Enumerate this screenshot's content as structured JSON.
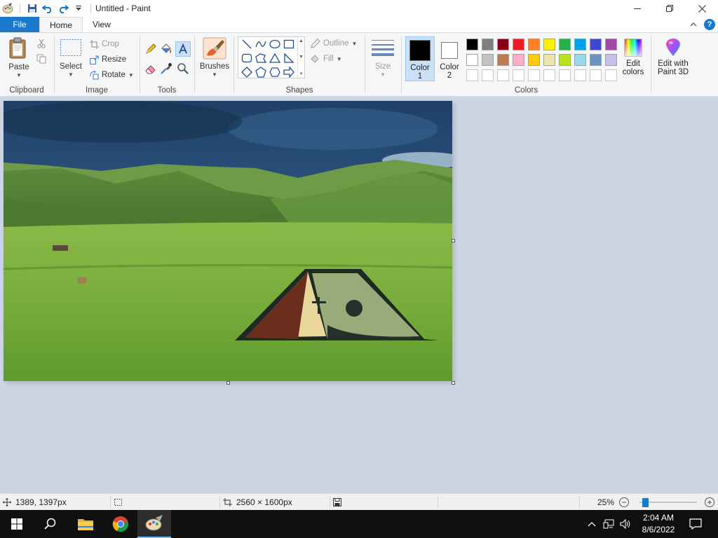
{
  "window": {
    "title": "Untitled - Paint",
    "controls": {
      "minimize": "minimize",
      "restore": "restore",
      "close": "close"
    }
  },
  "tabs": [
    {
      "label": "File"
    },
    {
      "label": "Home"
    },
    {
      "label": "View"
    }
  ],
  "ribbon": {
    "clipboard": {
      "group_label": "Clipboard",
      "paste_label": "Paste"
    },
    "image": {
      "group_label": "Image",
      "select_label": "Select",
      "crop_label": "Crop",
      "resize_label": "Resize",
      "rotate_label": "Rotate"
    },
    "tools": {
      "group_label": "Tools"
    },
    "brushes": {
      "label": "Brushes"
    },
    "shapes": {
      "group_label": "Shapes",
      "outline_label": "Outline",
      "fill_label": "Fill"
    },
    "size": {
      "label": "Size"
    },
    "colors": {
      "group_label": "Colors",
      "color1_label_line1": "Color",
      "color1_label_line2": "1",
      "color2_label_line1": "Color",
      "color2_label_line2": "2",
      "color1": "#000000",
      "color2": "#ffffff",
      "edit_colors_line1": "Edit",
      "edit_colors_line2": "colors",
      "paint3d_line1": "Edit with",
      "paint3d_line2": "Paint 3D",
      "palette_row1": [
        "#000000",
        "#7f7f7f",
        "#880015",
        "#ed1c24",
        "#ff7f27",
        "#fff200",
        "#22b14c",
        "#00a2e8",
        "#3f48cc",
        "#a349a4"
      ],
      "palette_row2": [
        "#ffffff",
        "#c3c3c3",
        "#b97a57",
        "#ffaec9",
        "#ffc90e",
        "#efe4b0",
        "#b5e61d",
        "#99d9ea",
        "#7092be",
        "#c8bfe7"
      ],
      "palette_row3": [
        "#ffffff",
        "#ffffff",
        "#ffffff",
        "#ffffff",
        "#ffffff",
        "#ffffff",
        "#ffffff",
        "#ffffff",
        "#ffffff",
        "#ffffff"
      ]
    }
  },
  "status": {
    "cursor_position": "1389, 1397px",
    "image_size": "2560 × 1600px",
    "zoom_level": "25%",
    "zoom_fraction": 0.1
  },
  "taskbar": {
    "time": "2:04 AM",
    "date": "8/6/2022"
  },
  "colors": {
    "accent": "#1979ca",
    "ribbon_bg": "#f5f6f7",
    "workspace_bg": "#ccd5e4",
    "taskbar_bg": "#101010"
  }
}
